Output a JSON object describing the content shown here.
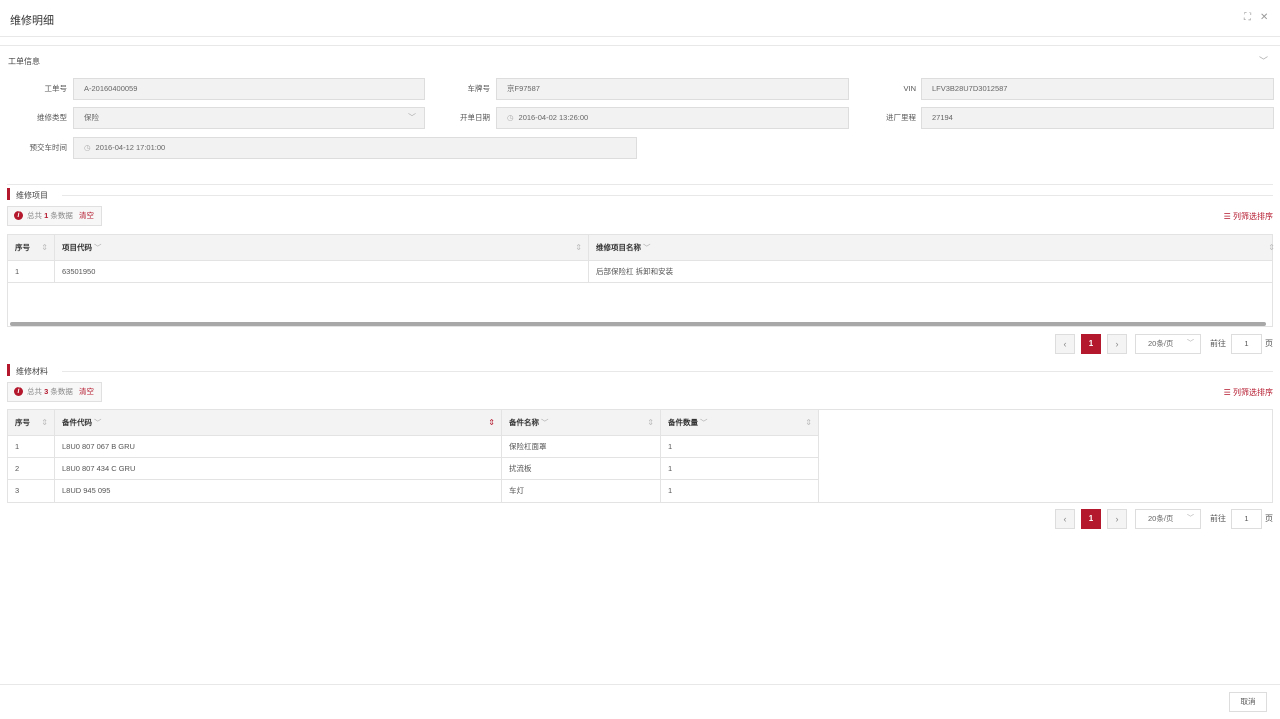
{
  "window": {
    "title": "维修明细",
    "maximize_glyph": "⛶",
    "close_glyph": "✕"
  },
  "work_order": {
    "section_title": "工单信息",
    "collapse_glyph": "﹀",
    "fields": {
      "order_no": {
        "label": "工单号",
        "value": "A-20160400059"
      },
      "plate_no": {
        "label": "车牌号",
        "value": "京F97587"
      },
      "vin": {
        "label": "VIN",
        "value": "LFV3B28U7D3012587"
      },
      "repair_type": {
        "label": "维修类型",
        "value": "保险"
      },
      "open_date": {
        "label": "开单日期",
        "value": "2016-04-02 13:26:00"
      },
      "mileage": {
        "label": "进厂里程",
        "value": "27194"
      },
      "delivery_time": {
        "label": "预交车时间",
        "value": "2016-04-12 17:01:00"
      }
    }
  },
  "items": {
    "section_title": "维修项目",
    "summary": {
      "prefix": "总共",
      "count": "1",
      "suffix": "条数据",
      "clear": "清空"
    },
    "column_sort": "列筛选排序",
    "columns": [
      "序号",
      "项目代码",
      "维修项目名称"
    ],
    "rows": [
      {
        "no": "1",
        "code": "63501950",
        "name": "后部保险杠 拆卸和安装"
      }
    ],
    "pager": {
      "current": "1",
      "page_size": "20条/页",
      "goto_label": "前往",
      "goto_value": "1",
      "page_unit": "页",
      "prev": "‹",
      "next": "›"
    }
  },
  "materials": {
    "section_title": "维修材料",
    "summary": {
      "prefix": "总共",
      "count": "3",
      "suffix": "条数据",
      "clear": "清空"
    },
    "column_sort": "列筛选排序",
    "columns": [
      "序号",
      "备件代码",
      "备件名称",
      "备件数量"
    ],
    "rows": [
      {
        "no": "1",
        "code": "L8U0 807 067 B GRU",
        "name": "保险杠面罩",
        "qty": "1"
      },
      {
        "no": "2",
        "code": "L8U0 807 434 C GRU",
        "name": "扰流板",
        "qty": "1"
      },
      {
        "no": "3",
        "code": "L8UD 945 095",
        "name": "车灯",
        "qty": "1"
      }
    ],
    "pager": {
      "current": "1",
      "page_size": "20条/页",
      "goto_label": "前往",
      "goto_value": "1",
      "page_unit": "页",
      "prev": "‹",
      "next": "›"
    }
  },
  "footer": {
    "cancel_label": "取消"
  },
  "colors": {
    "accent": "#b4182d",
    "readonly_bg": "#f2f2f2",
    "border": "#e3e3e3"
  }
}
